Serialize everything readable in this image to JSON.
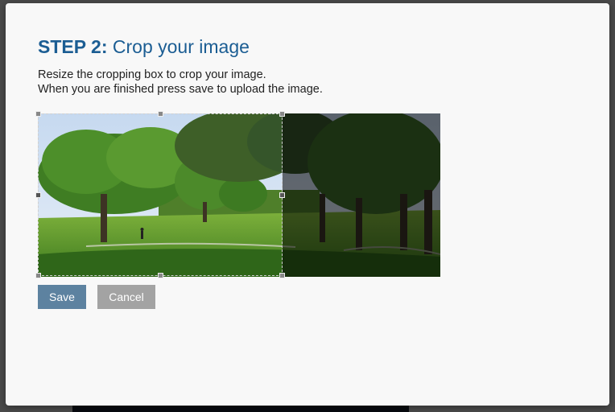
{
  "dialog": {
    "title_step": "STEP 2:",
    "title_text": "Crop your image",
    "instruction_line1": "Resize the cropping box to crop your image.",
    "instruction_line2": "When you are finished press save to upload the image."
  },
  "image": {
    "description": "park-photo",
    "crop_fraction_of_width": 0.61
  },
  "buttons": {
    "save_label": "Save",
    "cancel_label": "Cancel"
  },
  "colors": {
    "title": "#1b5d93",
    "save_button": "#5d82a0",
    "cancel_button": "#a3a3a3",
    "modal_background": "#f8f8f8"
  }
}
